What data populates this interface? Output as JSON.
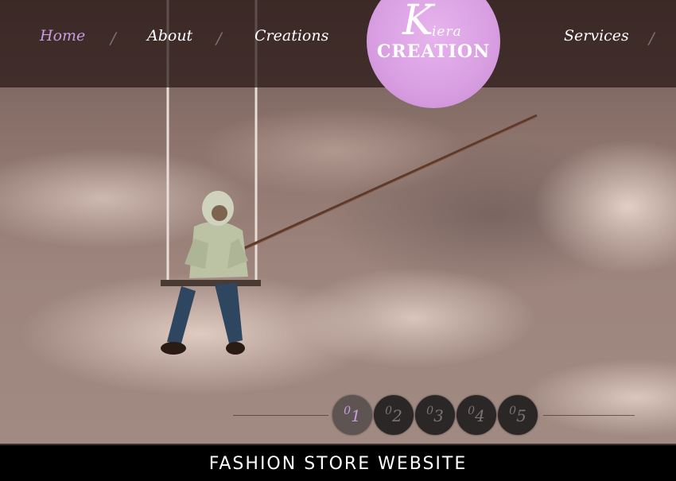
{
  "nav": {
    "items": [
      {
        "label": "Home"
      },
      {
        "label": "About"
      },
      {
        "label": "Creations"
      },
      {
        "label": "Services"
      }
    ],
    "separator": "/"
  },
  "logo": {
    "initial": "K",
    "word_top": "iera",
    "word_main": "CREATION"
  },
  "pager": {
    "items": [
      {
        "prefix": "0",
        "num": "1"
      },
      {
        "prefix": "0",
        "num": "2"
      },
      {
        "prefix": "0",
        "num": "3"
      },
      {
        "prefix": "0",
        "num": "4"
      },
      {
        "prefix": "0",
        "num": "5"
      }
    ],
    "active_index": 0
  },
  "caption": "FASHION STORE WEBSITE",
  "colors": {
    "accent": "#c99be0",
    "logo": "#d9a0e2",
    "band": "#28181",
    "caption_bg": "#000000"
  }
}
